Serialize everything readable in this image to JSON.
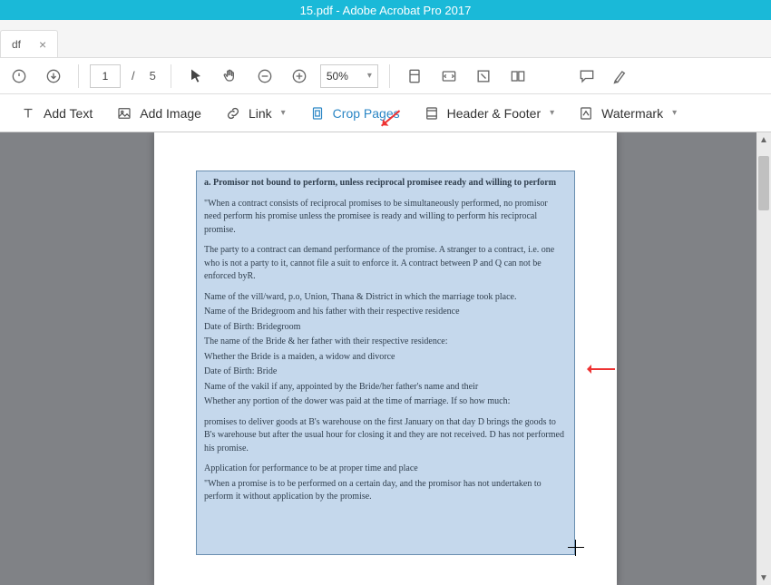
{
  "titlebar": {
    "title": "15.pdf - Adobe Acrobat Pro 2017"
  },
  "tab": {
    "label": "df",
    "close": "×"
  },
  "toolbar": {
    "page_current": "1",
    "page_sep": "/",
    "page_total": "5",
    "zoom": "50%"
  },
  "tools": {
    "add_text": "Add Text",
    "add_image": "Add Image",
    "link": "Link",
    "crop_pages": "Crop Pages",
    "header_footer": "Header & Footer",
    "watermark": "Watermark"
  },
  "doc": {
    "p1_head": "a. Promisor not bound to perform, unless reciprocal promisee ready and willing to perform",
    "p2": "\"When a contract consists of reciprocal promises to be simultaneously performed, no promisor need perform his promise unless the promisee is ready and willing to perform his reciprocal promise.",
    "p3": "The party to a contract can demand performance of the promise. A stranger to a contract, i.e. one who is not a party to it, cannot file a suit to enforce it. A contract between P and Q can not be enforced byR.",
    "p4": "Name of the vill/ward, p.o, Union, Thana & District in which the marriage took place.",
    "p5": "Name of the Bridegroom and his father with their respective residence",
    "p6": "Date of Birth: Bridegroom",
    "p7": "The name of the Bride & her father with their respective residence:",
    "p8": "Whether the Bride is a maiden, a widow and divorce",
    "p9": "Date of Birth: Bride",
    "p10": "Name of the vakil if any, appointed by the Bride/her father's name and their",
    "p11": "Whether any portion of the dower was paid at the time of marriage. If so how much:",
    "p12": "promises to deliver goods at B's warehouse on the first January on that day D brings the goods to B's warehouse but after the usual hour for closing it and they are not received. D has not performed his promise.",
    "p13": "Application for performance to be at proper time and place",
    "p14": "\"When a promise is to be performed on a certain day, and the promisor has not undertaken to perform it without application by the promise."
  },
  "scroll": {
    "up": "▲",
    "down": "▼"
  }
}
